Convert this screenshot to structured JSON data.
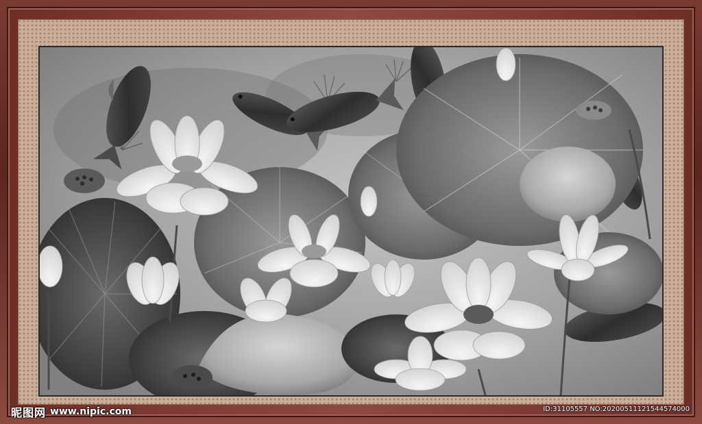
{
  "watermark": {
    "logo_text": "昵图网",
    "site": "www.nipic.com",
    "id_label": "ID:31105557 NO:20200511121544574000"
  },
  "painting": {
    "subject": "lotus-and-koi-ink-painting",
    "colors": {
      "frame_wood": "#6e2e28",
      "mat": "#c9ac98",
      "background": "#9b9b9b"
    }
  }
}
